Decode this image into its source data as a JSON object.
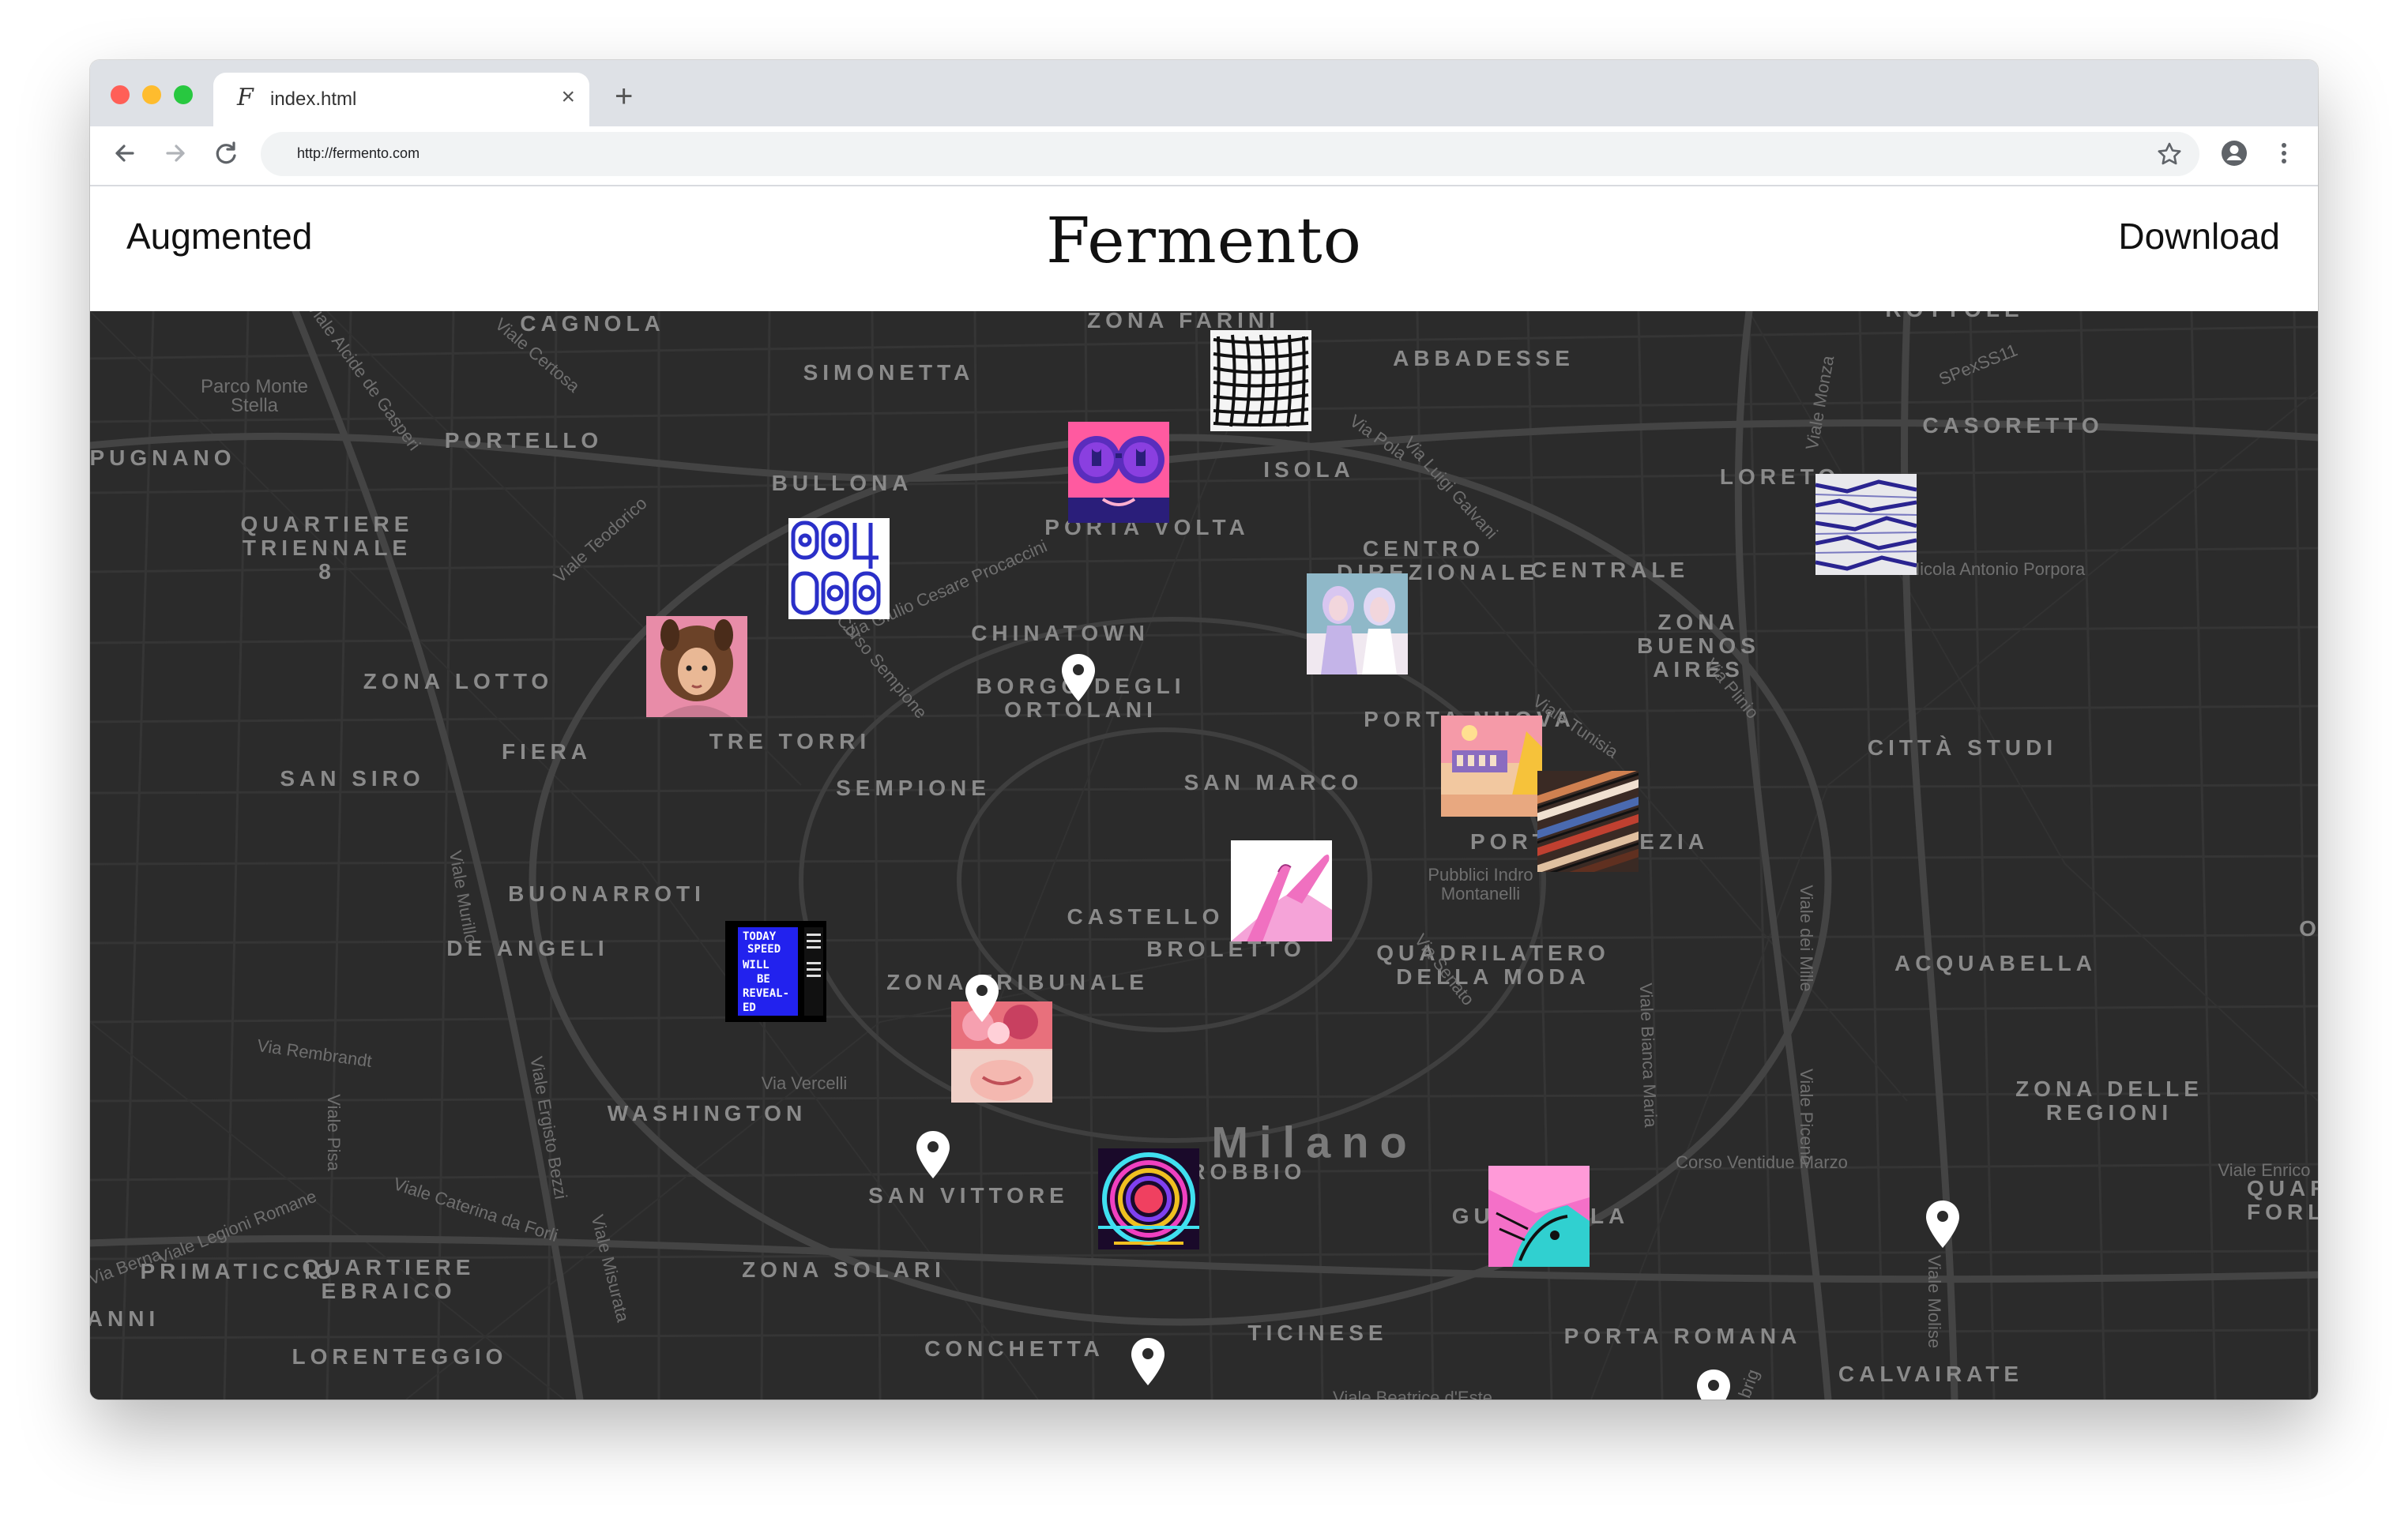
{
  "browser": {
    "tab_title": "index.html",
    "favicon_glyph": "F",
    "close_glyph": "×",
    "new_tab_glyph": "+",
    "url": "http://fermento.com"
  },
  "header": {
    "left_link": "Augmented",
    "brand": "Fermento",
    "right_link": "Download"
  },
  "map": {
    "city_label": "Milano",
    "districts": [
      "CAGNOLA",
      "ZONA FARINI",
      "SIMONETTA",
      "ABBADESSE",
      "PORTELLO",
      "PUGNANO",
      "CASORETTO",
      "BULLONA",
      "ISOLA",
      "LORETO",
      "QUARTIERE TRIENNALE 8",
      "PORTA VOLTA",
      "CENTRO DIREZIONALE",
      "CENTRALE",
      "CHINATOWN",
      "ZONA BUENOS AIRES",
      "ZONA LOTTO",
      "BORGO DEGLI ORTOLANI",
      "FIERA",
      "TRE TORRI",
      "PORTA NUOVA",
      "CITTÀ STUDI",
      "SAN SIRO",
      "SEMPIONE",
      "SAN MARCO",
      "BUONARROTI",
      "PORTA VENEZIA",
      "DE ANGELI",
      "CASTELLO",
      "ZONA TRIBUNALE",
      "BROLETTO",
      "QUADRILATERO DELLA MODA",
      "ACQUABELLA",
      "WASHINGTON",
      "ZONA DELLE REGIONI",
      "SAN VITTORE",
      "CARROBBIO",
      "GUASTALLA",
      "QUARTIERE EBRAICO",
      "PRIMATICCIO",
      "ZONA SOLARI",
      "TICINESE",
      "CONCHETTA",
      "PORTA ROMANA",
      "LORENTEGGIO",
      "CALVAIRATE",
      "ANNI",
      "QUAR FORL",
      "ROTTOLE",
      "O"
    ],
    "streets": [
      "Parco Monte Stella",
      "Viale Alcide de Gasperi",
      "Viale Certosa",
      "Viale Teodorico",
      "Via Giulio Cesare Procaccini",
      "Corso Sempione",
      "Via Pola",
      "Via Luigi Galvani",
      "Viale Monza",
      "SPexSS11",
      "Via Nicola Antonio Porpora",
      "Viale Tunisia",
      "Via Plinio",
      "Pubblici Indro Montanelli",
      "Viale Murillo",
      "Via Senato",
      "Viale dei Mille",
      "Viale Piceno",
      "Via Rembrandt",
      "Via Vercelli",
      "Viale Ergisto Bezzi",
      "Viale Pisa",
      "Viale Caterina da Forli",
      "Viale Legioni Romane",
      "Via Berna",
      "Viale Misurata",
      "Viale Bianca Maria",
      "Corso Ventidue Marzo",
      "Viale Enrico",
      "Viale Molise",
      "Viale Beatrice d'Este",
      "brig"
    ],
    "artworks": [
      "grid-warp-art",
      "purple-sunglasses-art",
      "number-pattern-art",
      "blue-scribble-art",
      "dog-hood-portrait-art",
      "twin-figures-art",
      "city-sunset-art",
      "striped-collage-art",
      "pink-legs-art",
      "today-speed-poster-art",
      "pink-faces-collage-art",
      "neon-disco-ball-art",
      "pink-comic-face-art"
    ],
    "colors": {
      "background": "#2b2b2b",
      "road": "#3a3a3a",
      "major_road": "#444444",
      "pin": "#ffffff"
    }
  },
  "poster_text": {
    "line1": "TODAY",
    "line2": "SPEED",
    "line3": "WILL",
    "line4": "BE",
    "line5": "REVEAL-",
    "line6": "ED"
  }
}
